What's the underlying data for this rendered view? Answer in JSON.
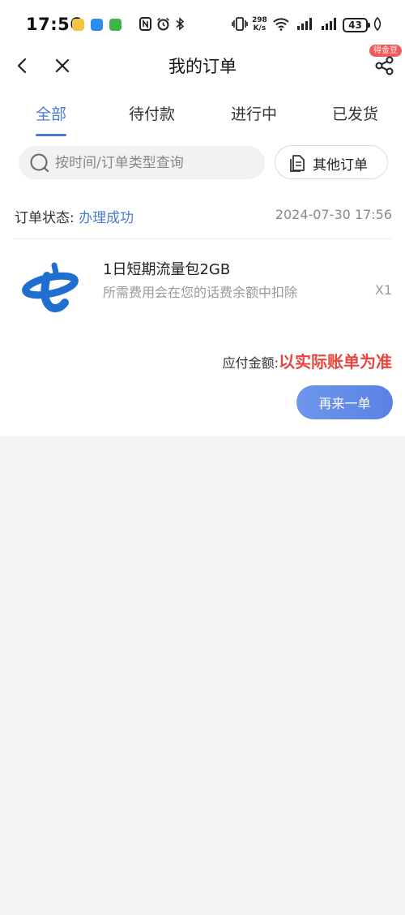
{
  "status_bar": {
    "time": "17:56",
    "net_speed_value": "298",
    "net_speed_unit": "K/s",
    "battery": "43"
  },
  "header": {
    "title": "我的订单",
    "badge": "得金豆"
  },
  "tabs": [
    {
      "label": "全部",
      "active": true
    },
    {
      "label": "待付款",
      "active": false
    },
    {
      "label": "进行中",
      "active": false
    },
    {
      "label": "已发货",
      "active": false
    }
  ],
  "search": {
    "placeholder": "按时间/订单类型查询",
    "other_orders_label": "其他订单"
  },
  "order": {
    "status_label": "订单状态:",
    "status_value": "办理成功",
    "datetime": "2024-07-30 17:56",
    "product_name": "1日短期流量包2GB",
    "product_desc": "所需费用会在您的话费余额中扣除",
    "quantity": "X1",
    "pay_label": "应付金额:",
    "pay_value": "以实际账单为准",
    "reorder_label": "再来一单"
  },
  "colors": {
    "accent": "#4a79d6",
    "price_red": "#e8453c",
    "background": "#f4f4f5"
  },
  "icons": [
    "back-icon",
    "close-icon",
    "share-icon",
    "search-icon",
    "document-icon",
    "telecom-logo-icon"
  ]
}
